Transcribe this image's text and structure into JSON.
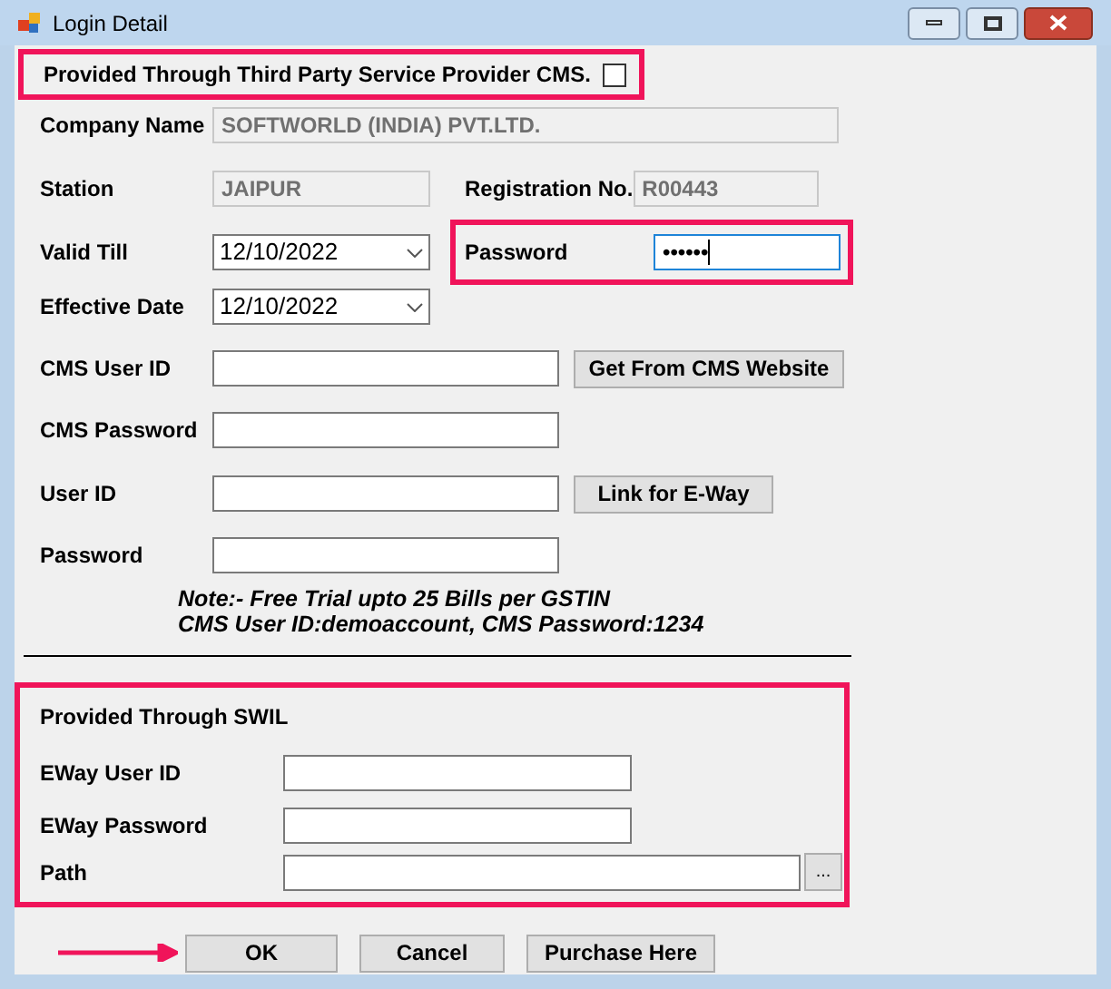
{
  "window": {
    "title": "Login Detail"
  },
  "third_party": {
    "label": "Provided Through Third Party Service Provider CMS.",
    "checked": false,
    "highlighted": true
  },
  "company_name": {
    "label": "Company Name",
    "value": "SOFTWORLD (INDIA) PVT.LTD.",
    "disabled": true
  },
  "station": {
    "label": "Station",
    "value": "JAIPUR",
    "disabled": true
  },
  "registration_no": {
    "label": "Registration No.",
    "value": "R00443",
    "disabled": true
  },
  "valid_till": {
    "label": "Valid Till",
    "value": "12/10/2022"
  },
  "password_top": {
    "label": "Password",
    "value": "••••••",
    "focused": true,
    "highlighted": true
  },
  "effective_date": {
    "label": "Effective Date",
    "value": "12/10/2022"
  },
  "cms_user_id": {
    "label": "CMS User ID",
    "button": "Get From CMS Website"
  },
  "cms_password": {
    "label": "CMS Password"
  },
  "user_id": {
    "label": "User ID",
    "button": "Link for E-Way"
  },
  "password": {
    "label": "Password"
  },
  "note": [
    "Note:- Free Trial upto 25 Bills per GSTIN",
    "CMS User ID:demoaccount, CMS Password:1234"
  ],
  "swil": {
    "title": "Provided Through SWIL",
    "highlighted": true,
    "eway_user_id": {
      "label": "EWay User ID"
    },
    "eway_password": {
      "label": "EWay Password"
    },
    "path": {
      "label": "Path",
      "browse": "..."
    }
  },
  "buttons": [
    {
      "label": "OK",
      "pointed": true
    },
    {
      "label": "Cancel",
      "pointed": false
    },
    {
      "label": "Purchase Here",
      "pointed": false
    }
  ]
}
